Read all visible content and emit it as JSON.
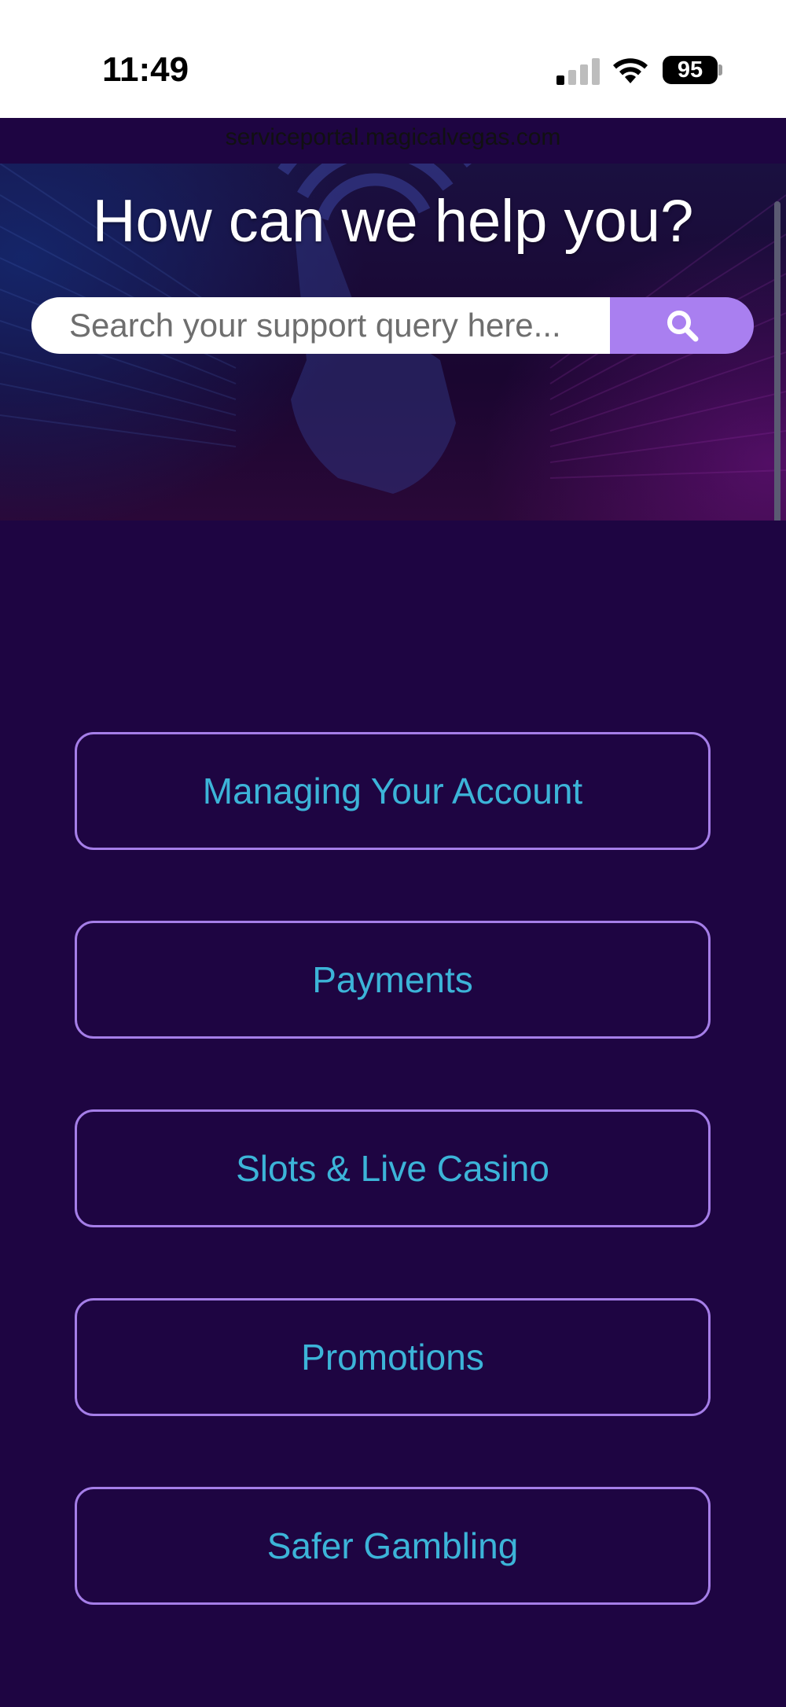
{
  "status_bar": {
    "time": "11:49",
    "battery_level": "95",
    "icons": [
      "cellular-signal-icon",
      "wifi-icon",
      "battery-icon"
    ]
  },
  "browser": {
    "url": "serviceportal.magicalvegas.com"
  },
  "hero": {
    "title": "How can we help you?",
    "search_placeholder": "Search your support query here...",
    "search_icon": "search-icon"
  },
  "categories": [
    {
      "label": "Managing Your Account"
    },
    {
      "label": "Payments"
    },
    {
      "label": "Slots & Live Casino"
    },
    {
      "label": "Promotions"
    },
    {
      "label": "Safer Gambling"
    }
  ],
  "colors": {
    "background": "#1e0542",
    "accent": "#a97ff0",
    "button_text": "#3cb4d8",
    "button_border": "#a57ee8"
  }
}
